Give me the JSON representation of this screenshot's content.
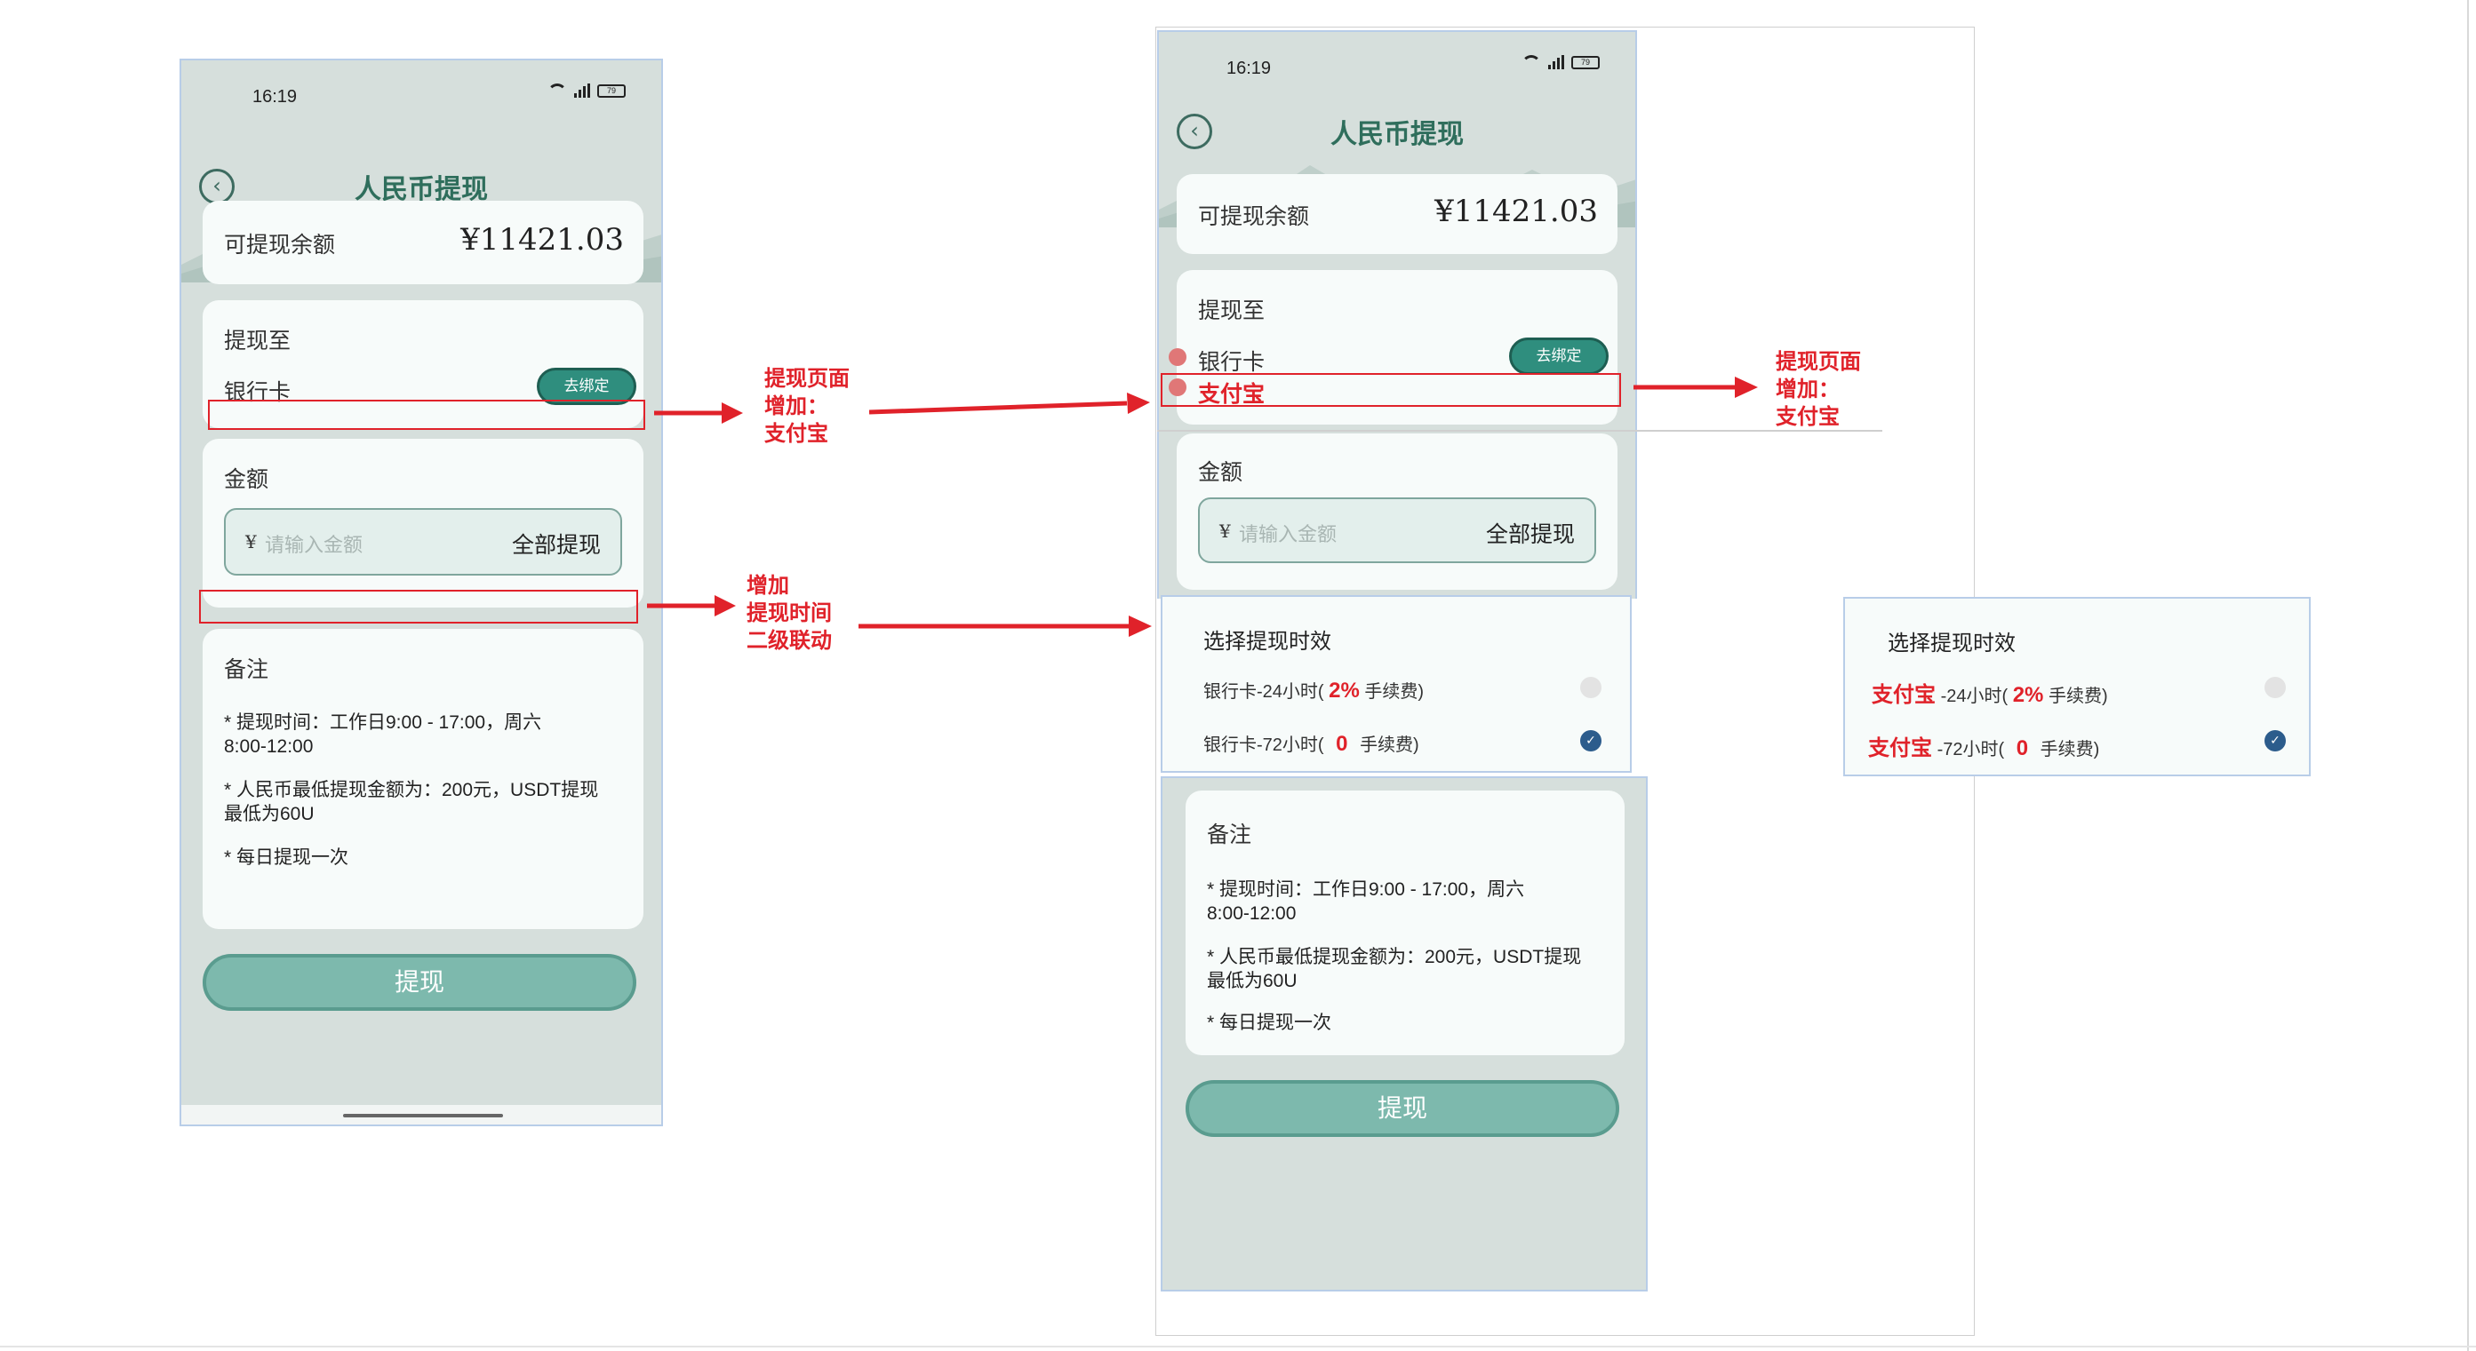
{
  "status": {
    "time": "16:19",
    "battery": "79"
  },
  "page": {
    "title": "人民币提现",
    "back_icon": "chevron-left-icon"
  },
  "balance": {
    "label": "可提现余额",
    "value": "¥11421.03"
  },
  "withdraw_to": {
    "title": "提现至",
    "bank_card": "银行卡",
    "bind_button": "去绑定",
    "alipay": "支付宝"
  },
  "amount": {
    "title": "金额",
    "currency_symbol": "¥",
    "placeholder": "请输入金额",
    "all_button": "全部提现"
  },
  "timeliness": {
    "title": "选择提现时效",
    "bank_24_prefix": "银行卡-24小时(",
    "bank_72_prefix": "银行卡-72小时(",
    "alipay_label": "支付宝",
    "alipay_24_suffix": "-24小时(",
    "alipay_72_suffix": "-72小时(",
    "fee_24": "2%",
    "fee_72": "0",
    "fee_suffix": "手续费)"
  },
  "notes": {
    "title": "备注",
    "line1a": "* 提现时间：工作日9:00 - 17:00，周六",
    "line1b": "8:00-12:00",
    "line2a": "* 人民币最低提现金额为：200元，USDT提现",
    "line2b": "最低为60U",
    "line3": "* 每日提现一次"
  },
  "submit": {
    "label": "提现"
  },
  "annotations": {
    "a1_l1": "提现页面",
    "a1_l2": "增加：",
    "a1_l3": "支付宝",
    "a2_l1": "增加",
    "a2_l2": "提现时间",
    "a2_l3": "二级联动"
  },
  "colors": {
    "accent": "#2f8e7e",
    "annotation_red": "#e0222a",
    "phone_bg": "#d6dfdc",
    "checked_blue": "#2c5c8c"
  }
}
